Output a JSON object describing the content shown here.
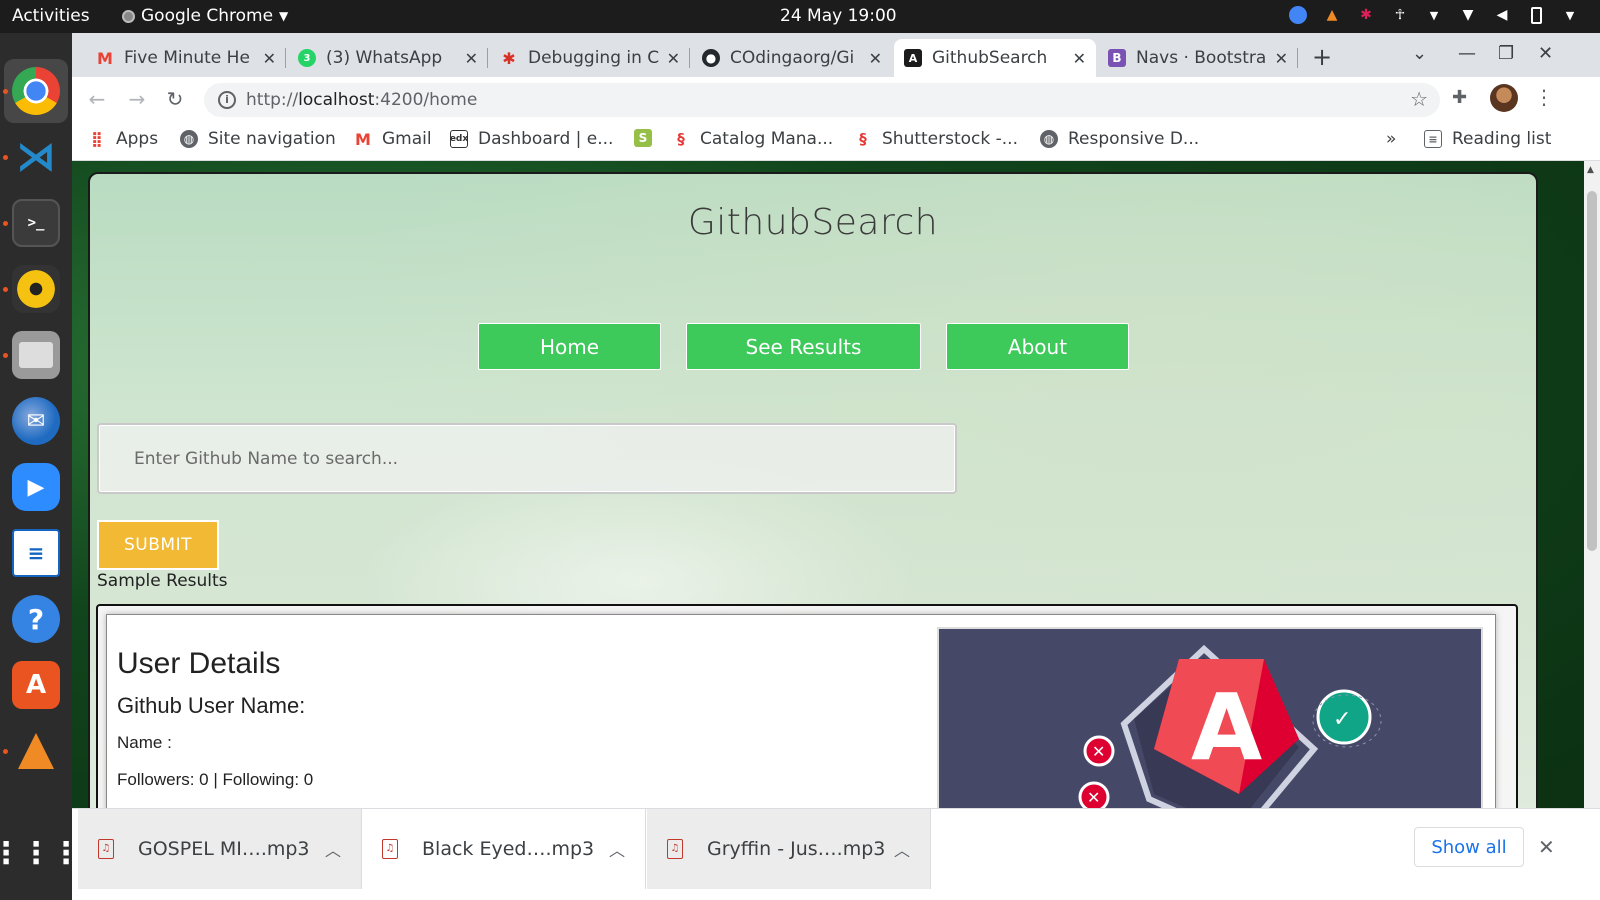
{
  "topbar": {
    "activities": "Activities",
    "app_name": "Google Chrome",
    "clock": "24 May  19:00"
  },
  "tabs": [
    {
      "title": "Five Minute He",
      "icon": "gmail-icon",
      "color": "#ea4335"
    },
    {
      "title": "(3) WhatsApp",
      "icon": "whatsapp-icon",
      "color": "#25d366"
    },
    {
      "title": "Debugging in C",
      "icon": "bug-icon",
      "color": "#d93025"
    },
    {
      "title": "COdingaorg/Gi",
      "icon": "github-icon",
      "color": "#24292e"
    },
    {
      "title": "GithubSearch",
      "icon": "angular-icon",
      "color": "#1c1c1c",
      "active": true
    },
    {
      "title": "Navs · Bootstra",
      "icon": "bootstrap-icon",
      "color": "#7952b3"
    }
  ],
  "omnibar": {
    "url_prefix": "http://",
    "url_host": "localhost",
    "url_rest": ":4200/home"
  },
  "bookmarks": [
    {
      "label": "Apps",
      "icon": "apps-grid-icon"
    },
    {
      "label": "Site navigation",
      "icon": "globe-icon"
    },
    {
      "label": "Gmail",
      "icon": "gmail-icon"
    },
    {
      "label": "Dashboard | e...",
      "icon": "dashboard-icon"
    },
    {
      "label": "",
      "icon": "shopify-icon"
    },
    {
      "label": "Catalog Mana...",
      "icon": "catalog-icon"
    },
    {
      "label": "Shutterstock -...",
      "icon": "shutterstock-icon"
    },
    {
      "label": "Responsive D...",
      "icon": "globe-icon"
    }
  ],
  "bookmarks_overflow": "»",
  "reading_list": "Reading list",
  "page": {
    "site_title": "GithubSearch",
    "nav": {
      "home": "Home",
      "results": "See  Results",
      "about": "About"
    },
    "search_placeholder": "Enter Github Name to search...",
    "submit": "SUBMIT",
    "sample_label": "Sample Results",
    "user_details": {
      "title": "User Details",
      "username_label": "Github User Name:",
      "name_label": "Name :",
      "followers_line": "Followers: 0 | Following: 0"
    }
  },
  "downloads": [
    {
      "file": "GOSPEL MI….mp3"
    },
    {
      "file": "Black Eyed….mp3"
    },
    {
      "file": "Gryffin - Jus….mp3"
    }
  ],
  "show_all": "Show all",
  "colors": {
    "nav_button": "#3ec95b",
    "submit_button": "#f1b934",
    "link_blue": "#1a73e8"
  }
}
